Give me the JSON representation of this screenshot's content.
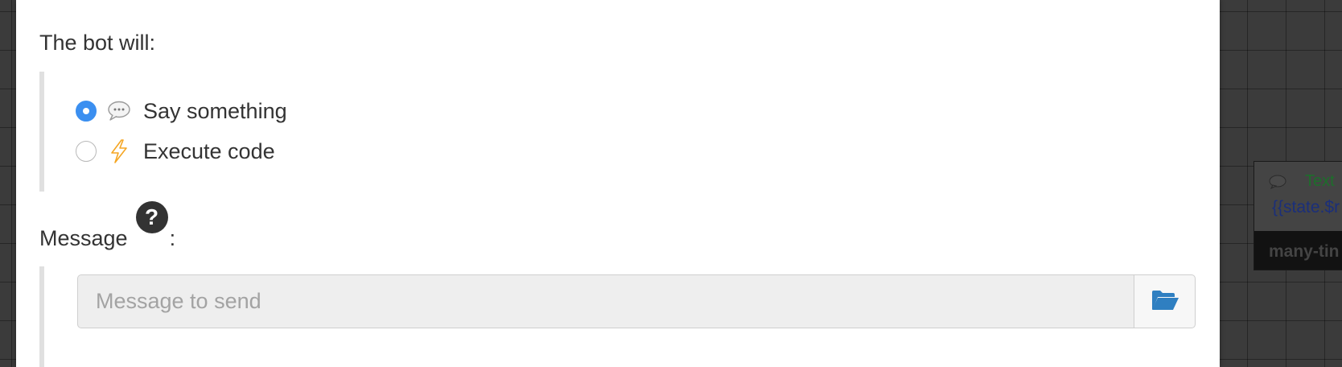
{
  "modal": {
    "bot_will_label": "The bot will:",
    "options": [
      {
        "label": "Say something",
        "icon": "speech-bubble-icon",
        "selected": true
      },
      {
        "label": "Execute code",
        "icon": "lightning-icon",
        "selected": false
      }
    ],
    "message_label": "Message",
    "message_help_icon": "?",
    "message_colon": ":",
    "message_input": {
      "placeholder": "Message to send",
      "value": ""
    },
    "folder_button_icon": "folder-open-icon"
  },
  "background_node": {
    "type_label": "Text",
    "variable_text": "{{state.$r",
    "name": "many-tin"
  },
  "colors": {
    "accent": "#3b8ff0",
    "folder_icon": "#2f7fc1",
    "lightning": "#f5a623",
    "text": "#333333"
  }
}
